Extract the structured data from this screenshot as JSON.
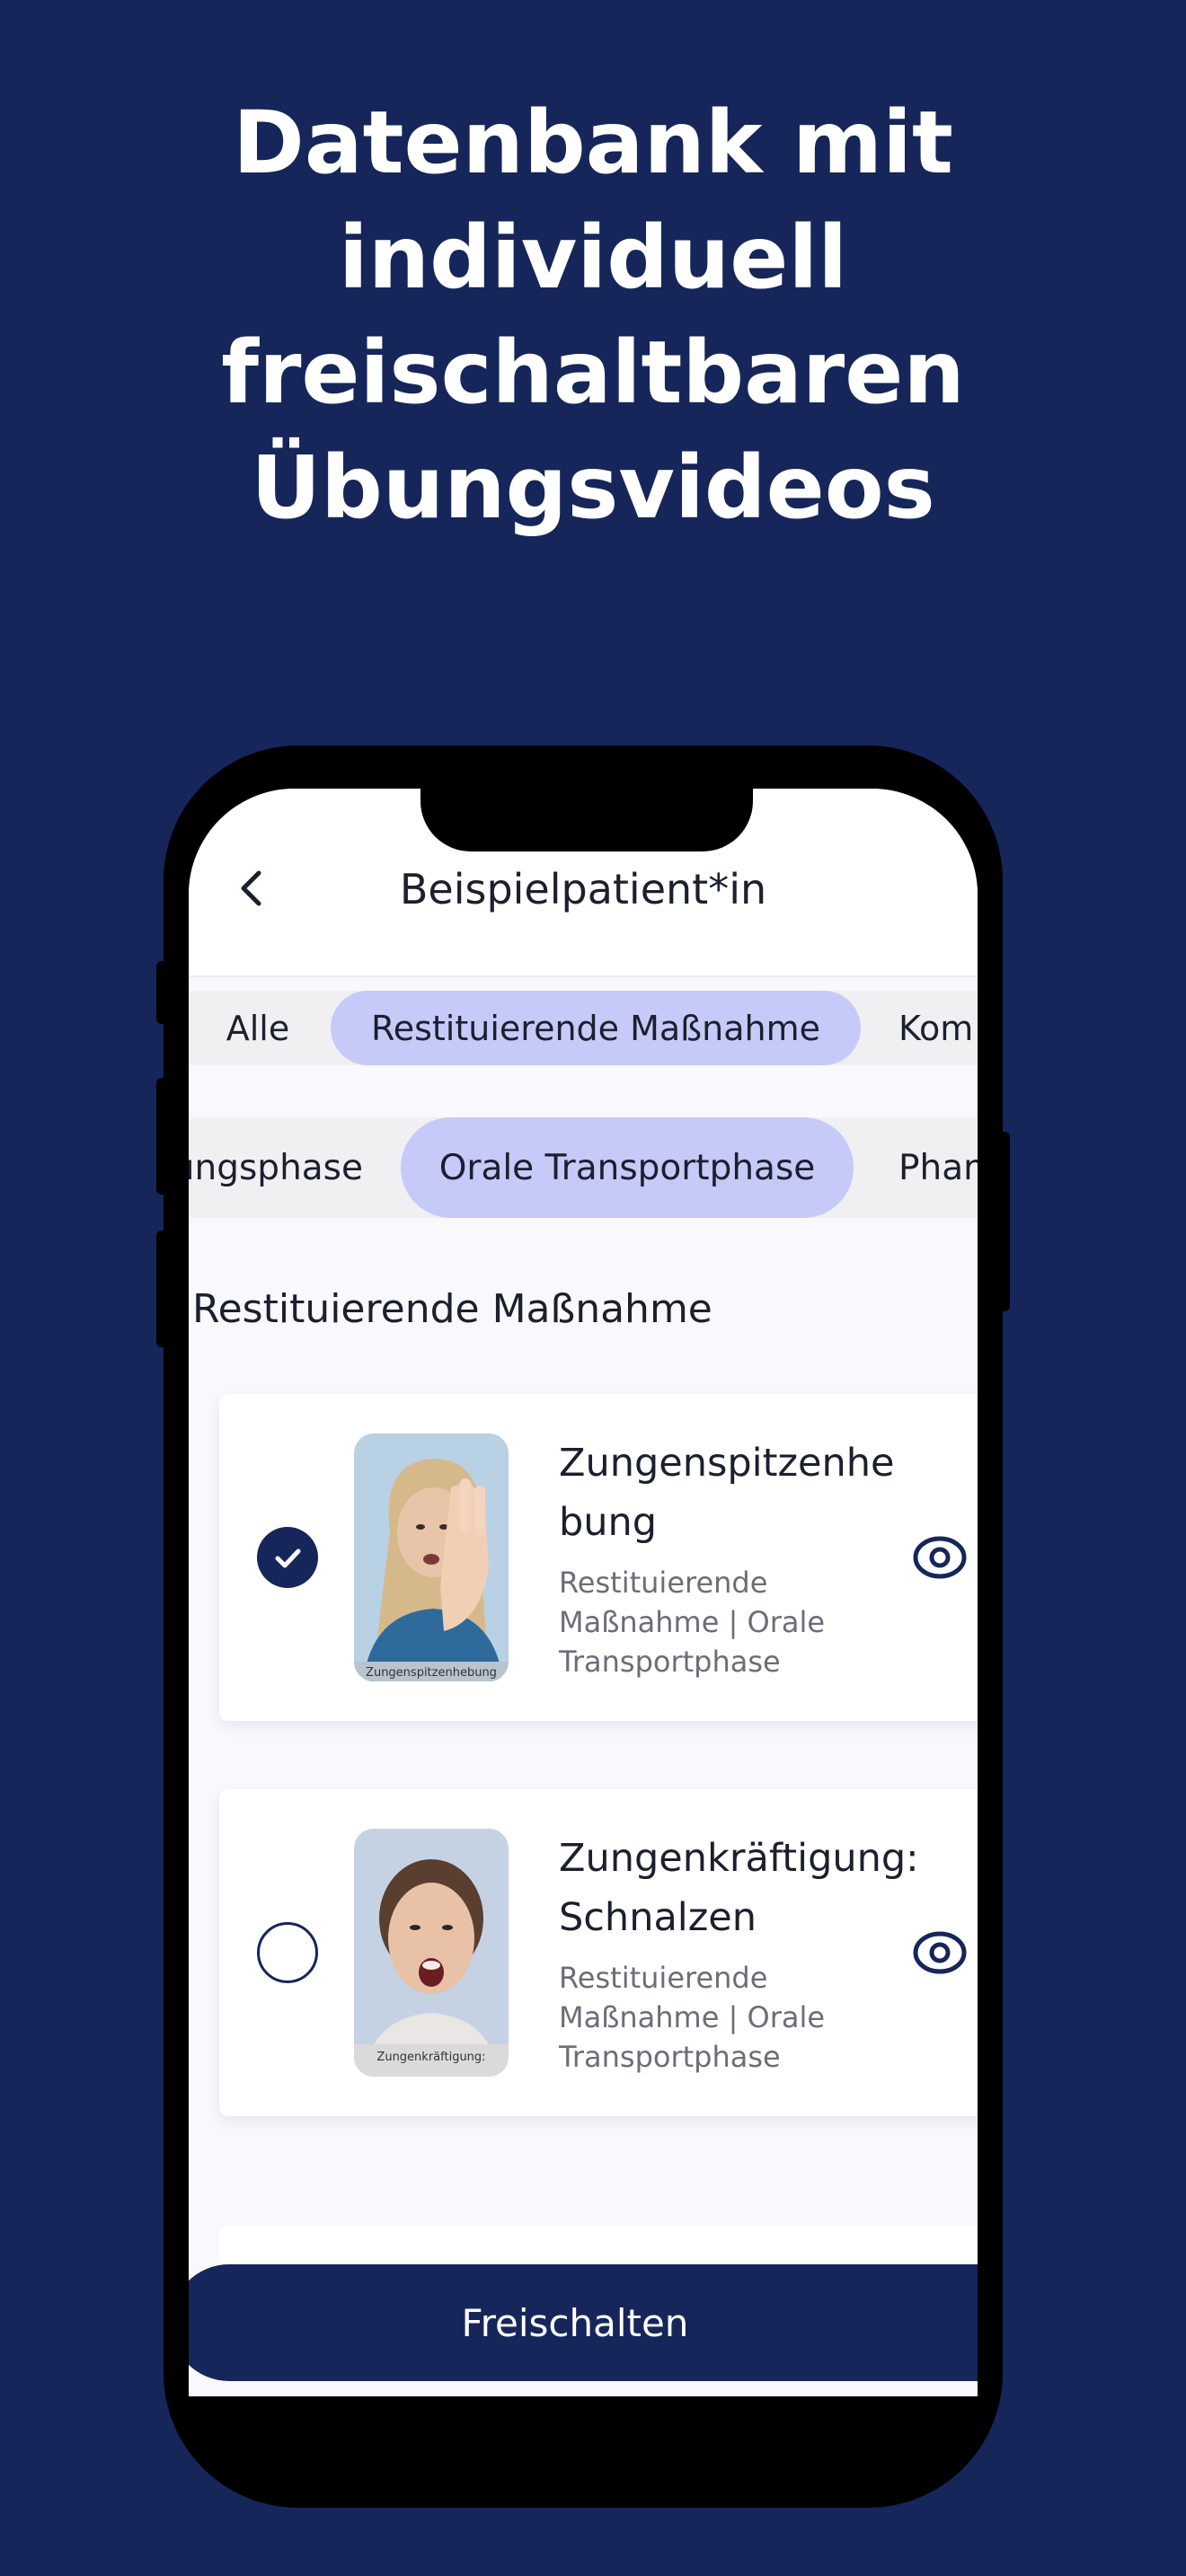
{
  "headline": {
    "lines": [
      "Datenbank mit",
      "individuell",
      "freischaltbaren",
      "Übungsvideos"
    ]
  },
  "app": {
    "title": "Beispielpatient*in",
    "back_icon": "chevron-left-icon"
  },
  "filters": {
    "category_chips": [
      "Alle",
      "Restituierende Maßnahme",
      "Kom"
    ],
    "category_selected": "Restituierende Maßnahme",
    "phase_chips": [
      "ungsphase",
      "Orale Transportphase",
      "Phar"
    ],
    "phase_selected": "Orale Transportphase"
  },
  "section": {
    "title": "Restituierende Maßnahme"
  },
  "exercises": [
    {
      "title": "Zungenspitzenhebung",
      "subtitle": "Restituierende Maßnahme | Orale Transportphase",
      "thumb_caption": "Zungenspitzenhebung",
      "selected": true,
      "view_icon": "eye-icon"
    },
    {
      "title": "Zungenkräftigung: Schnalzen",
      "subtitle": "Restituierende Maßnahme | Orale Transportphase",
      "thumb_caption": "Zungenkräftigung:",
      "selected": false,
      "view_icon": "eye-icon"
    }
  ],
  "actions": {
    "unlock_label": "Freischalten"
  },
  "colors": {
    "background": "#16265a",
    "chip_active": "#c5caf8",
    "primary": "#16265a"
  }
}
